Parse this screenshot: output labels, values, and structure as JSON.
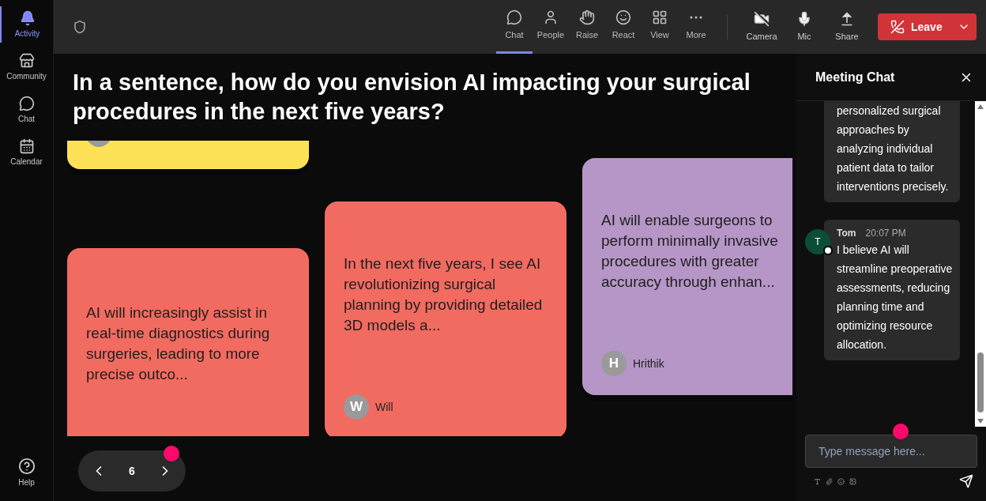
{
  "rail": [
    {
      "label": "Activity",
      "selected": true
    },
    {
      "label": "Community",
      "selected": false
    },
    {
      "label": "Chat",
      "selected": false
    },
    {
      "label": "Calendar",
      "selected": false
    }
  ],
  "help": {
    "label": "Help"
  },
  "toolbar": [
    {
      "label": "Chat",
      "selected": true
    },
    {
      "label": "People",
      "selected": false
    },
    {
      "label": "Raise",
      "selected": false
    },
    {
      "label": "React",
      "selected": false
    },
    {
      "label": "View",
      "selected": false
    },
    {
      "label": "More",
      "selected": false
    }
  ],
  "devices": [
    {
      "label": "Camera"
    },
    {
      "label": "Mic"
    },
    {
      "label": "Share"
    }
  ],
  "leave": {
    "label": "Leave"
  },
  "question": "In a sentence, how do you envision AI impacting your surgical procedures in the next five years?",
  "columns": [
    [
      {
        "color": "#fde257"
      },
      {
        "color": "#f26b61",
        "text": "AI will increasingly assist in real-time diagnostics during surgeries, leading to more precise outco..."
      }
    ],
    [
      {
        "color": "#f26b61",
        "text": "In the next five years, I see AI revolutionizing surgical planning by providing detailed 3D models a...",
        "initial": "W",
        "author": "Will"
      }
    ],
    [
      {
        "color": "#b696c6",
        "text": "AI will enable surgeons to perform minimally invasive procedures with greater accuracy through enhan...",
        "initial": "H",
        "author": "Hrithik"
      }
    ]
  ],
  "pager": {
    "page": "6"
  },
  "chat": {
    "title": "Meeting Chat",
    "messages": [
      {
        "text": "personalized surgical approaches by analyzing individual patient data to tailor interventions precisely."
      },
      {
        "initial": "T",
        "author": "Tom",
        "time": "20:07 PM",
        "text": "I believe AI will streamline preoperative assessments, reducing planning time and optimizing resource allocation."
      }
    ],
    "placeholder": "Type message here..."
  }
}
